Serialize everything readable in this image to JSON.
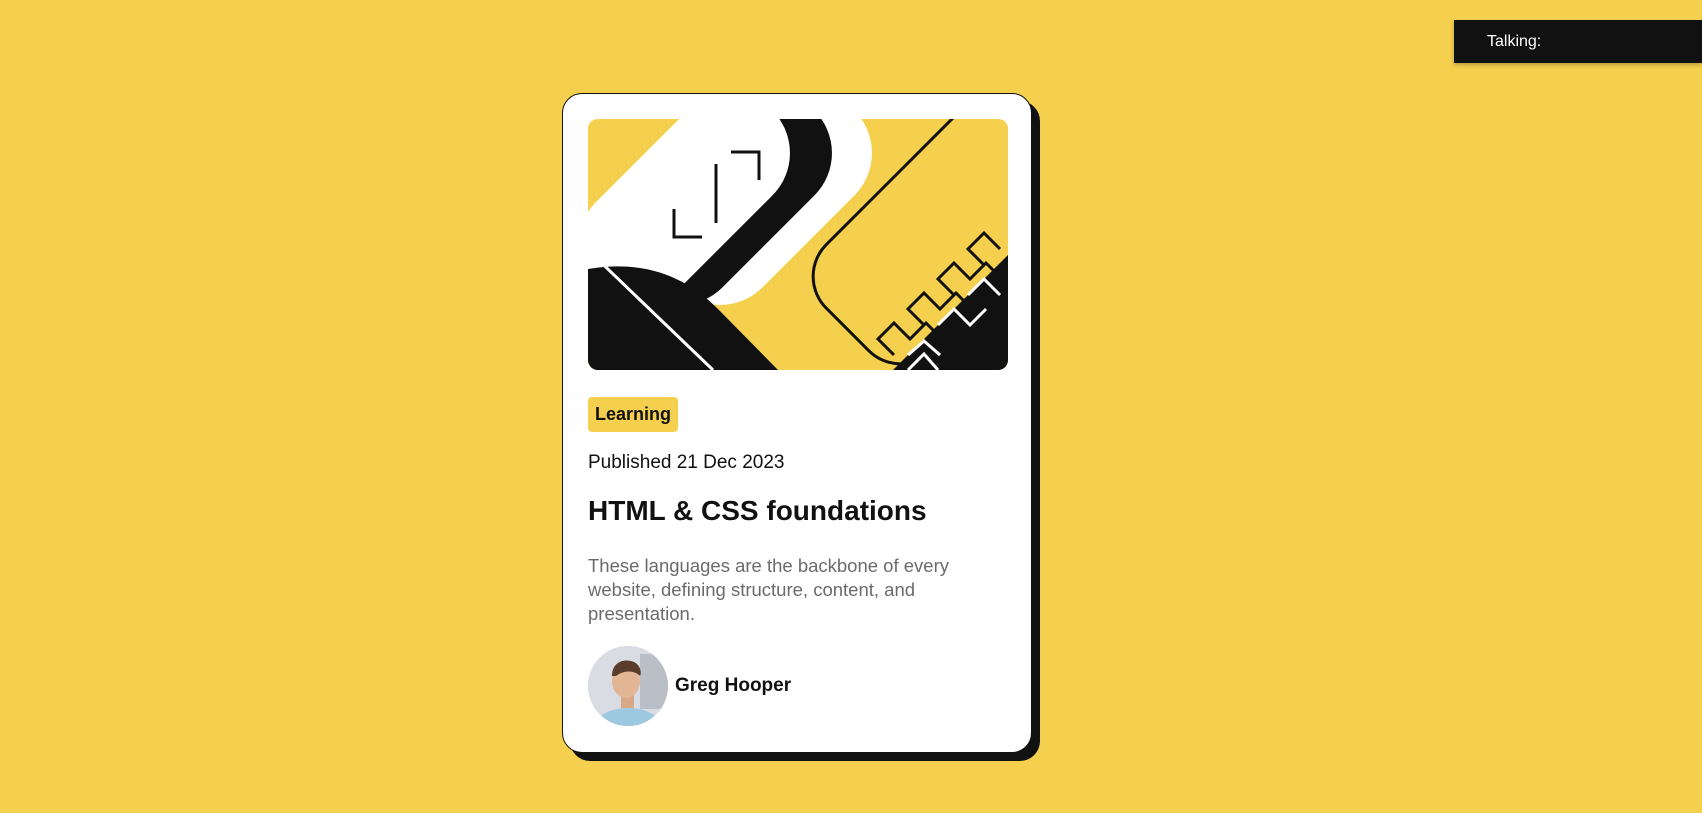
{
  "overlay": {
    "talking_label": "Talking:"
  },
  "card": {
    "tag_label": "Learning",
    "published": "Published 21 Dec 2023",
    "title": "HTML & CSS foundations",
    "description": "These languages are the backbone of every website, defining structure, content, and presentation.",
    "author_name": "Greg Hooper"
  },
  "colors": {
    "background": "#F4D04E",
    "ink": "#111111",
    "card": "#FFFFFF",
    "muted_text": "#6B6B6B"
  }
}
